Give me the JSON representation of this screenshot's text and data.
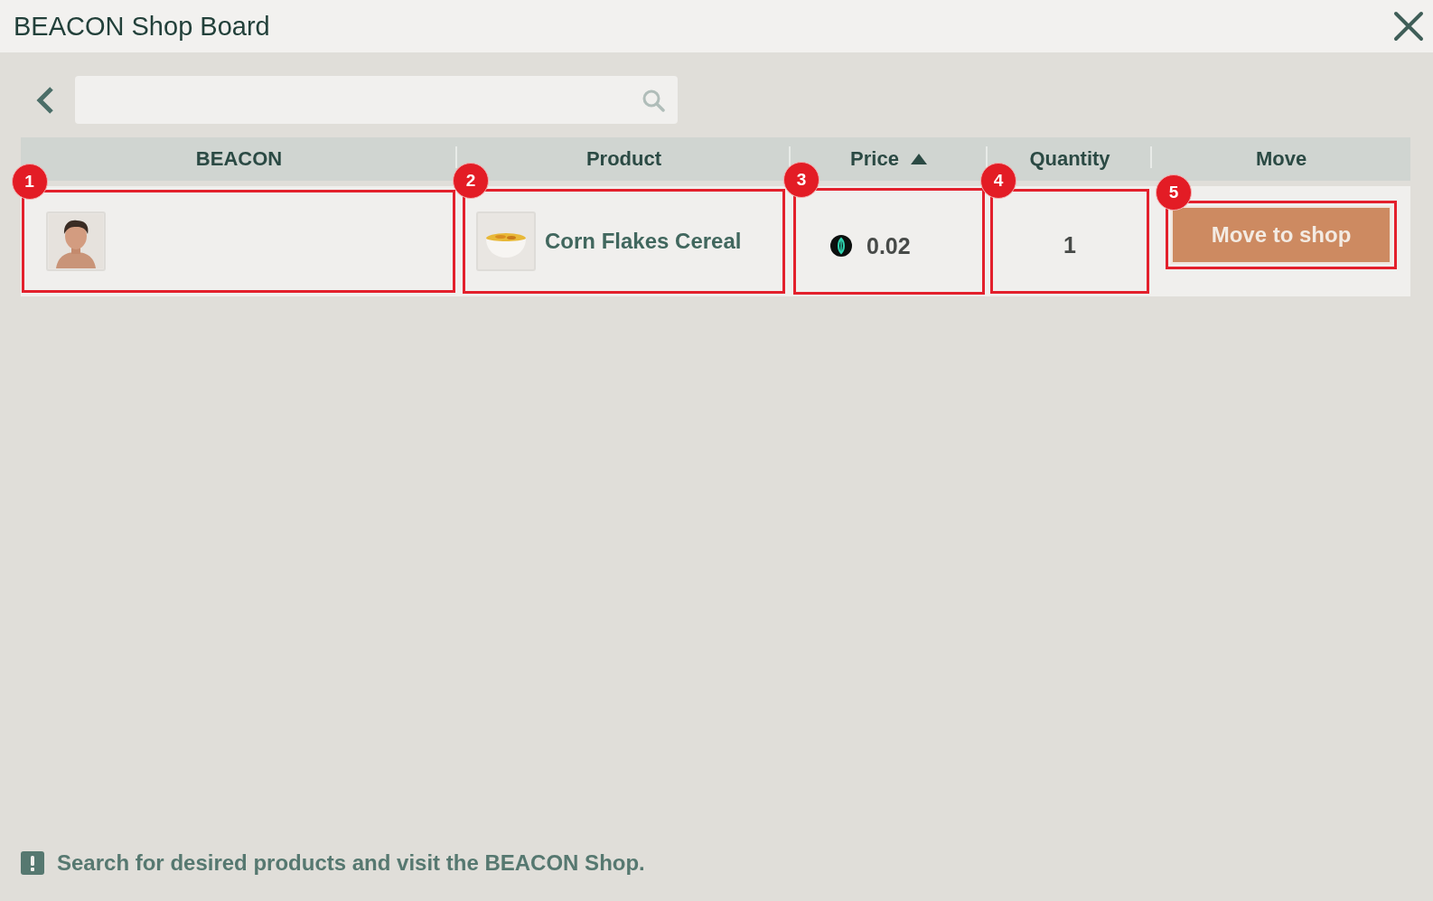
{
  "window": {
    "title": "BEACON Shop Board"
  },
  "table": {
    "columns": [
      {
        "label": "BEACON",
        "sorted": false
      },
      {
        "label": "Product",
        "sorted": false
      },
      {
        "label": "Price",
        "sorted": true
      },
      {
        "label": "Quantity",
        "sorted": false
      },
      {
        "label": "Move",
        "sorted": false
      }
    ],
    "rows": [
      {
        "beacon": {
          "callout": "1"
        },
        "product": {
          "name": "Corn Flakes Cereal",
          "callout": "2"
        },
        "price": {
          "value": "0.02",
          "callout": "3"
        },
        "quantity": {
          "value": "1",
          "callout": "4"
        },
        "move": {
          "label": "Move to shop",
          "callout": "5"
        }
      }
    ]
  },
  "hint": "Search for desired products and visit the BEACON Shop."
}
